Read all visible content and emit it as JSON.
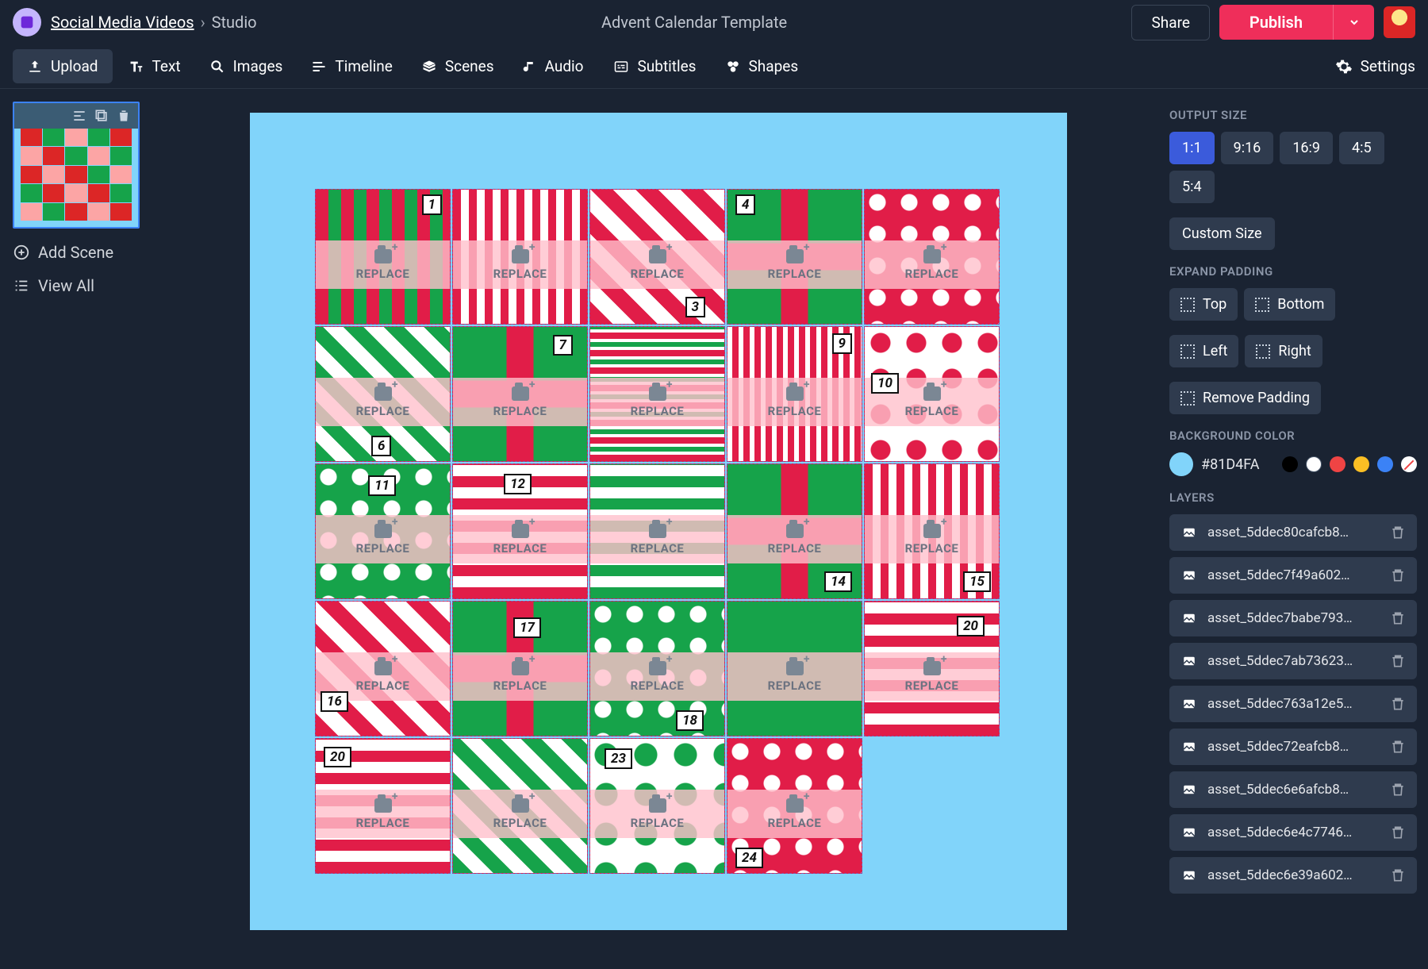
{
  "header": {
    "breadcrumb_link": "Social Media Videos",
    "breadcrumb_sep": "›",
    "breadcrumb_current": "Studio",
    "title": "Advent Calendar Template",
    "share_label": "Share",
    "publish_label": "Publish"
  },
  "toolbar": {
    "upload": "Upload",
    "text": "Text",
    "images": "Images",
    "timeline": "Timeline",
    "scenes": "Scenes",
    "audio": "Audio",
    "subtitles": "Subtitles",
    "shapes": "Shapes",
    "settings": "Settings"
  },
  "left": {
    "add_scene": "Add Scene",
    "view_all": "View All"
  },
  "canvas": {
    "replace_label": "REPLACE",
    "bg_color": "#81D4FA",
    "cells": [
      {
        "num": "1",
        "num_pos": "top:6px;right:10px;",
        "pat": "pat-rg-stripe"
      },
      {
        "num": "",
        "num_pos": "",
        "pat": "pat-rw-stripe"
      },
      {
        "num": "3",
        "num_pos": "bottom:8px;right:24px;",
        "pat": "pat-diag"
      },
      {
        "num": "4",
        "num_pos": "top:6px;left:10px;",
        "pat": "pat-green-cross"
      },
      {
        "num": "",
        "num_pos": "",
        "pat": "pat-dots-rw"
      },
      {
        "num": "6",
        "num_pos": "bottom:6px;left:70px;",
        "pat": "pat-gw-diag"
      },
      {
        "num": "7",
        "num_pos": "top:10px;right:18px;",
        "pat": "pat-green-cross"
      },
      {
        "num": "",
        "num_pos": "",
        "pat": "pat-hstripe"
      },
      {
        "num": "9",
        "num_pos": "top:8px;right:12px;",
        "pat": "pat-rw-thin"
      },
      {
        "num": "10",
        "num_pos": "top:58px;left:8px;",
        "pat": "pat-dots-wr"
      },
      {
        "num": "11",
        "num_pos": "top:14px;right:68px;",
        "pat": "pat-dots-gw"
      },
      {
        "num": "12",
        "num_pos": "top:12px;right:70px;",
        "pat": "pat-plaid"
      },
      {
        "num": "",
        "num_pos": "",
        "pat": "pat-plaid-g"
      },
      {
        "num": "14",
        "num_pos": "bottom:8px;right:12px;",
        "pat": "pat-green-cross"
      },
      {
        "num": "15",
        "num_pos": "bottom:8px;right:10px;",
        "pat": "pat-rw-stripe"
      },
      {
        "num": "16",
        "num_pos": "bottom:30px;left:6px;",
        "pat": "pat-diag"
      },
      {
        "num": "17",
        "num_pos": "top:20px;right:58px;",
        "pat": "pat-green-cross"
      },
      {
        "num": "18",
        "num_pos": "bottom:6px;right:26px;",
        "pat": "pat-dots-gw"
      },
      {
        "num": "",
        "num_pos": "",
        "pat": "pat-green-solid"
      },
      {
        "num": "20",
        "num_pos": "top:18px;right:18px;",
        "pat": "pat-plaid"
      },
      {
        "num": "20",
        "num_pos": "top:10px;left:10px;",
        "pat": "pat-plaid"
      },
      {
        "num": "",
        "num_pos": "",
        "pat": "pat-gw-diag"
      },
      {
        "num": "23",
        "num_pos": "top:12px;left:18px;",
        "pat": "pat-dots-wg"
      },
      {
        "num": "24",
        "num_pos": "bottom:6px;left:10px;",
        "pat": "pat-dots-rw"
      }
    ]
  },
  "right": {
    "output_size_title": "OUTPUT SIZE",
    "ratios": [
      "1:1",
      "9:16",
      "16:9",
      "4:5",
      "5:4"
    ],
    "active_ratio": "1:1",
    "custom_size": "Custom Size",
    "expand_padding_title": "EXPAND PADDING",
    "pad_top": "Top",
    "pad_bottom": "Bottom",
    "pad_left": "Left",
    "pad_right": "Right",
    "remove_padding": "Remove Padding",
    "bg_title": "BACKGROUND COLOR",
    "bg_hex": "#81D4FA",
    "layers_title": "LAYERS",
    "layers": [
      "asset_5ddec80cafcb8…",
      "asset_5ddec7f49a602…",
      "asset_5ddec7babe793…",
      "asset_5ddec7ab73623…",
      "asset_5ddec763a12e5…",
      "asset_5ddec72eafcb8…",
      "asset_5ddec6e6afcb8…",
      "asset_5ddec6e4c7746…",
      "asset_5ddec6e39a602…"
    ]
  }
}
